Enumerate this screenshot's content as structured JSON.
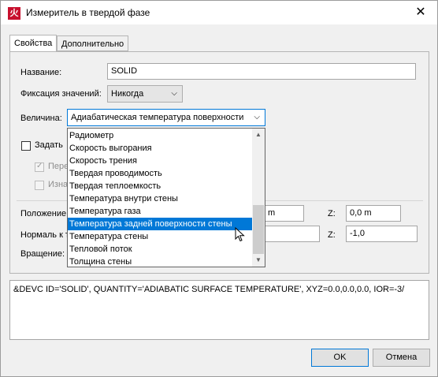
{
  "window": {
    "title": "Измеритель в твердой фазе",
    "close_glyph": "✕",
    "app_icon_glyph": "火"
  },
  "tabs": [
    {
      "label": "Свойства"
    },
    {
      "label": "Дополнительно"
    }
  ],
  "form": {
    "name_label": "Название:",
    "name_value": "SOLID",
    "freeze_label": "Фиксация значений:",
    "freeze_value": "Никогда",
    "quantity_label": "Величина:",
    "quantity_value": "Адиабатическая температура поверхности",
    "assign_label": "Задать",
    "option1_label": "Пере",
    "option2_label": "Изна",
    "position_label": "Положение",
    "position_y_suffix": "m",
    "position_z_label": "Z:",
    "position_z_value": "0,0 m",
    "normal_label": "Нормаль к т",
    "normal_z_label": "Z:",
    "normal_z_value": "-1,0",
    "rotation_label": "Вращение:"
  },
  "dropdown": {
    "items": [
      "Радиометр",
      "Скорость выгорания",
      "Скорость трения",
      "Твердая проводимость",
      "Твердая теплоемкость",
      "Температура внутри стены",
      "Температура газа",
      "Температура задней поверхности стены",
      "Температура стены",
      "Тепловой поток",
      "Толщина стены"
    ],
    "selected_index": 7
  },
  "code": "&DEVC ID='SOLID', QUANTITY='ADIABATIC SURFACE TEMPERATURE', XYZ=0.0,0.0,0.0, IOR=-3/",
  "buttons": {
    "ok": "OK",
    "cancel": "Отмена"
  }
}
